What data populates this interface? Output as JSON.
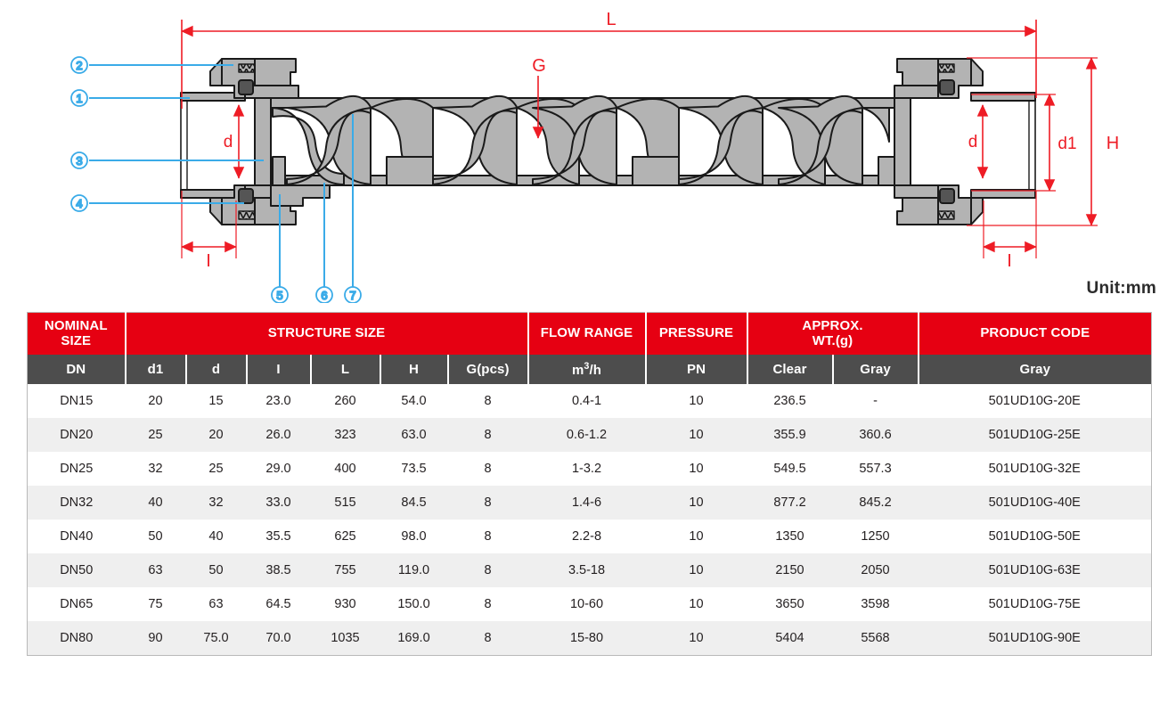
{
  "diagram": {
    "title": "static-mixer-sectional-drawing",
    "unit_note": "Unit:mm",
    "dimension_labels": {
      "length": "L",
      "inner_diameter_left": "d",
      "inner_diameter_right": "d",
      "outer_diameter": "d1",
      "height": "H",
      "insert_left": "I",
      "insert_right": "I",
      "element_pointer": "G"
    },
    "callouts": [
      {
        "id": "1",
        "glyph": "①"
      },
      {
        "id": "2",
        "glyph": "②"
      },
      {
        "id": "3",
        "glyph": "③"
      },
      {
        "id": "4",
        "glyph": "④"
      },
      {
        "id": "5",
        "glyph": "⑤"
      },
      {
        "id": "6",
        "glyph": "⑥"
      },
      {
        "id": "7",
        "glyph": "⑦"
      }
    ],
    "colors": {
      "dimension": "#ee1c25",
      "leader": "#3aabe8",
      "body_fill": "#b3b3b3",
      "outline": "#1a1a1a"
    }
  },
  "table": {
    "accent_red": "#e60012",
    "subheader_gray": "#4d4d4d",
    "group_headers": [
      {
        "label": "NOMINAL\nSIZE",
        "span": 1
      },
      {
        "label": "STRUCTURE SIZE",
        "span": 6
      },
      {
        "label": "FLOW RANGE",
        "span": 1
      },
      {
        "label": "PRESSURE",
        "span": 1
      },
      {
        "label": "APPROX.\nWT.(g)",
        "span": 2
      },
      {
        "label": "PRODUCT CODE",
        "span": 1
      }
    ],
    "sub_headers": [
      "DN",
      "d1",
      "d",
      "I",
      "L",
      "H",
      "G(pcs)",
      "m³/h",
      "PN",
      "Clear",
      "Gray",
      "Gray"
    ],
    "rows": [
      [
        "DN15",
        "20",
        "15",
        "23.0",
        "260",
        "54.0",
        "8",
        "0.4-1",
        "10",
        "236.5",
        "-",
        "501UD10G-20E"
      ],
      [
        "DN20",
        "25",
        "20",
        "26.0",
        "323",
        "63.0",
        "8",
        "0.6-1.2",
        "10",
        "355.9",
        "360.6",
        "501UD10G-25E"
      ],
      [
        "DN25",
        "32",
        "25",
        "29.0",
        "400",
        "73.5",
        "8",
        "1-3.2",
        "10",
        "549.5",
        "557.3",
        "501UD10G-32E"
      ],
      [
        "DN32",
        "40",
        "32",
        "33.0",
        "515",
        "84.5",
        "8",
        "1.4-6",
        "10",
        "877.2",
        "845.2",
        "501UD10G-40E"
      ],
      [
        "DN40",
        "50",
        "40",
        "35.5",
        "625",
        "98.0",
        "8",
        "2.2-8",
        "10",
        "1350",
        "1250",
        "501UD10G-50E"
      ],
      [
        "DN50",
        "63",
        "50",
        "38.5",
        "755",
        "119.0",
        "8",
        "3.5-18",
        "10",
        "2150",
        "2050",
        "501UD10G-63E"
      ],
      [
        "DN65",
        "75",
        "63",
        "64.5",
        "930",
        "150.0",
        "8",
        "10-60",
        "10",
        "3650",
        "3598",
        "501UD10G-75E"
      ],
      [
        "DN80",
        "90",
        "75.0",
        "70.0",
        "1035",
        "169.0",
        "8",
        "15-80",
        "10",
        "5404",
        "5568",
        "501UD10G-90E"
      ]
    ]
  }
}
